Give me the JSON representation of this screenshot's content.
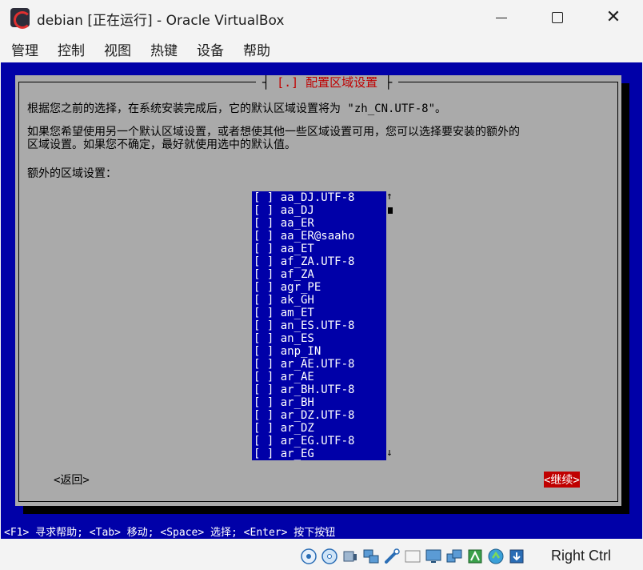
{
  "window": {
    "title": "debian [正在运行] - Oracle VirtualBox"
  },
  "menu": [
    "管理",
    "控制",
    "视图",
    "热键",
    "设备",
    "帮助"
  ],
  "dialog": {
    "title": "[.] 配置区域设置",
    "title_bar_left": "┤",
    "title_bar_right": "├",
    "desc1": "根据您之前的选择，在系统安装完成后，它的默认区域设置将为 \"zh_CN.UTF-8\"。",
    "desc2_line1": "如果您希望使用另一个默认区域设置，或者想使其他一些区域设置可用，您可以选择要安装的额外的",
    "desc2_line2": "区域设置。如果您不确定，最好就使用选中的默认值。",
    "section_label": "额外的区域设置：",
    "locales": [
      "[ ] aa_DJ.UTF-8",
      "[ ] aa_DJ",
      "[ ] aa_ER",
      "[ ] aa_ER@saaho",
      "[ ] aa_ET",
      "[ ] af_ZA.UTF-8",
      "[ ] af_ZA",
      "[ ] agr_PE",
      "[ ] ak_GH",
      "[ ] am_ET",
      "[ ] an_ES.UTF-8",
      "[ ] an_ES",
      "[ ] anp_IN",
      "[ ] ar_AE.UTF-8",
      "[ ] ar_AE",
      "[ ] ar_BH.UTF-8",
      "[ ] ar_BH",
      "[ ] ar_DZ.UTF-8",
      "[ ] ar_DZ",
      "[ ] ar_EG.UTF-8",
      "[ ] ar_EG"
    ],
    "scroll_up": "↑",
    "scroll_down": "↓",
    "back_label": "<返回>",
    "continue_label": "<继续>"
  },
  "helpline": "<F1> 寻求帮助; <Tab> 移动; <Space> 选择; <Enter> 按下按钮",
  "statusbar": {
    "icons": [
      "hard-disk-icon",
      "optical-disk-icon",
      "audio-icon",
      "network-icon",
      "usb-icon",
      "shared-folders-icon",
      "display-icon",
      "recording-icon",
      "cpu-icon",
      "mouse-integration-icon",
      "keyboard-icon"
    ],
    "host_key": "Right Ctrl"
  },
  "colors": {
    "vm_background": "#0000a8",
    "dialog_background": "#aaaaaa",
    "accent_red": "#c00000"
  }
}
